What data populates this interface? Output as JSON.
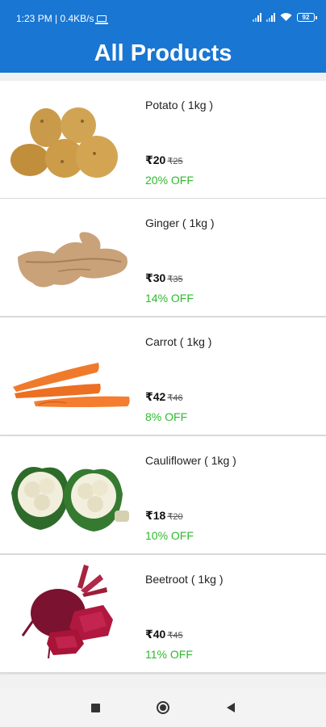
{
  "status_bar": {
    "time_info": "1:23 PM | 0.4KB/s",
    "battery": "92"
  },
  "header": {
    "title": "All Products"
  },
  "products": [
    {
      "name": "Potato ( 1kg )",
      "price": "₹20",
      "mrp": "₹25",
      "discount": "20% OFF"
    },
    {
      "name": "Ginger ( 1kg )",
      "price": "₹30",
      "mrp": "₹35",
      "discount": "14% OFF"
    },
    {
      "name": " Carrot ( 1kg )",
      "price": "₹42",
      "mrp": "₹46",
      "discount": "8% OFF"
    },
    {
      "name": "Cauliflower ( 1kg )",
      "price": "₹18",
      "mrp": "₹20",
      "discount": "10% OFF"
    },
    {
      "name": "Beetroot ( 1kg )",
      "price": "₹40",
      "mrp": "₹45",
      "discount": "11% OFF"
    }
  ],
  "colors": {
    "primary": "#1976d2",
    "discount": "#2eb82e"
  },
  "nav": {
    "icons": [
      "recents-icon",
      "home-icon",
      "back-icon"
    ]
  }
}
